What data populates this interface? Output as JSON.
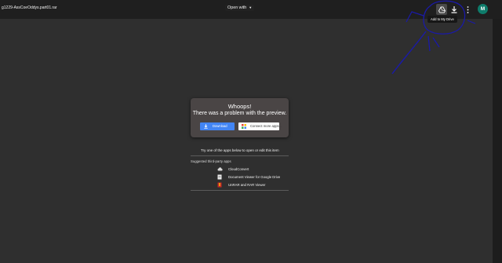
{
  "header": {
    "filename": "g1229-AssCoeOddys.part01.rar",
    "open_with_label": "Open with",
    "avatar_initial": "M",
    "tooltip": "Add to My Drive"
  },
  "dialog": {
    "title": "Whoops!",
    "subtitle": "There was a problem with the preview.",
    "download_label": "Download",
    "connect_label": "Connect more apps..."
  },
  "apps_section": {
    "prompt": "Try one of the apps below to open or edit this item",
    "suggested_heading": "Suggested third-party apps",
    "apps": [
      {
        "label": "CloudConvert",
        "icon": "cloud-icon"
      },
      {
        "label": "Document Viewer for Google Drive",
        "icon": "document-icon"
      },
      {
        "label": "UnRAR and RAR Viewer",
        "icon": "archive-icon"
      }
    ]
  },
  "colors": {
    "background": "#2f2f2f",
    "topbar": "#1f1f1f",
    "dialog": "#4a4545",
    "accent": "#4285f4",
    "avatar": "#0e7c6b",
    "annotation": "#1a1aa8"
  }
}
